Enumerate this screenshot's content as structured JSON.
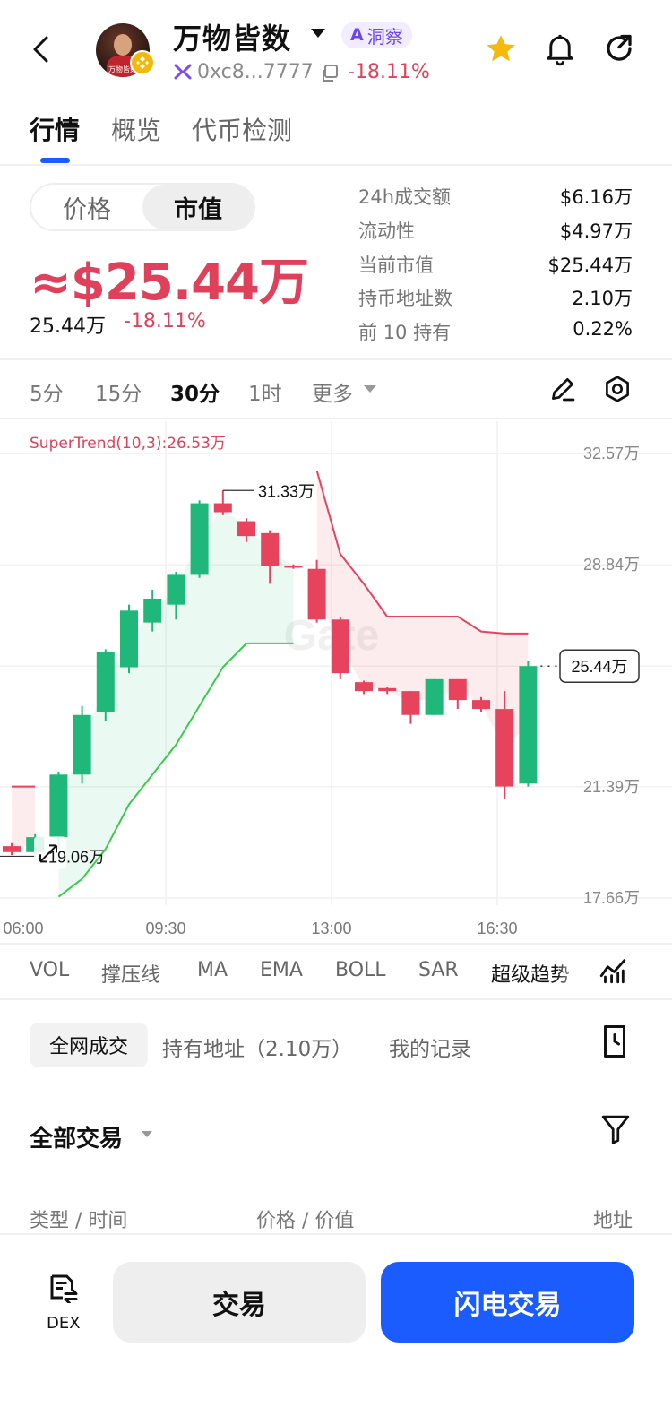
{
  "header": {
    "title": "万物皆数",
    "avatar_caption": "万物皆数",
    "ai_badge": "洞察",
    "address": "0xc8...7777",
    "change": "-18.11%"
  },
  "tabs": [
    "行情",
    "概览",
    "代币检测"
  ],
  "toggle": {
    "left": "价格",
    "right": "市值"
  },
  "market_cap": "≈$25.44万",
  "sub_value": "25.44万",
  "sub_change": "-18.11%",
  "stats": [
    {
      "label": "24h成交额",
      "value": "$6.16万"
    },
    {
      "label": "流动性",
      "value": "$4.97万"
    },
    {
      "label": "当前市值",
      "value": "$25.44万"
    },
    {
      "label": "持币地址数",
      "value": "2.10万"
    },
    {
      "label": "前 10 持有",
      "value": "0.22%"
    }
  ],
  "intervals": [
    "5分",
    "15分",
    "30分",
    "1时",
    "更多"
  ],
  "active_interval": "30分",
  "chart_data": {
    "type": "candlestick",
    "indicator_label": "SuperTrend(10,3):26.53万",
    "y_ticks": [
      "32.57万",
      "28.84万",
      "25.44万",
      "21.39万",
      "17.66万"
    ],
    "x_ticks": [
      "06:00",
      "09:30",
      "13:00",
      "16:30"
    ],
    "ylim": [
      17.66,
      32.57
    ],
    "unit": "万",
    "high_label": "31.33万",
    "low_label": "19.06万",
    "current_label": "25.44万",
    "candles": [
      {
        "o": 19.4,
        "c": 19.2,
        "h": 19.5,
        "l": 19.1
      },
      {
        "o": 19.2,
        "c": 19.7,
        "h": 19.8,
        "l": 19.1
      },
      {
        "o": 19.7,
        "c": 21.8,
        "h": 21.9,
        "l": 19.3
      },
      {
        "o": 21.8,
        "c": 23.8,
        "h": 24.1,
        "l": 21.5
      },
      {
        "o": 23.9,
        "c": 25.9,
        "h": 26.0,
        "l": 23.6
      },
      {
        "o": 25.4,
        "c": 27.3,
        "h": 27.5,
        "l": 25.2
      },
      {
        "o": 26.9,
        "c": 27.7,
        "h": 28.0,
        "l": 26.6
      },
      {
        "o": 27.5,
        "c": 28.5,
        "h": 28.6,
        "l": 27.0
      },
      {
        "o": 28.5,
        "c": 30.9,
        "h": 31.0,
        "l": 28.4
      },
      {
        "o": 30.9,
        "c": 30.6,
        "h": 31.33,
        "l": 30.5
      },
      {
        "o": 30.3,
        "c": 29.8,
        "h": 30.4,
        "l": 29.6
      },
      {
        "o": 29.9,
        "c": 28.8,
        "h": 30.0,
        "l": 28.2
      },
      {
        "o": 28.8,
        "c": 28.75,
        "h": 28.85,
        "l": 28.7
      },
      {
        "o": 28.7,
        "c": 27.0,
        "h": 29.0,
        "l": 26.9
      },
      {
        "o": 27.0,
        "c": 25.2,
        "h": 27.1,
        "l": 25.0
      },
      {
        "o": 24.9,
        "c": 24.6,
        "h": 24.95,
        "l": 24.5
      },
      {
        "o": 24.7,
        "c": 24.6,
        "h": 24.75,
        "l": 24.5
      },
      {
        "o": 24.6,
        "c": 23.8,
        "h": 24.6,
        "l": 23.5
      },
      {
        "o": 23.8,
        "c": 25.0,
        "h": 25.0,
        "l": 23.8
      },
      {
        "o": 25.0,
        "c": 24.3,
        "h": 25.0,
        "l": 24.0
      },
      {
        "o": 24.3,
        "c": 24.0,
        "h": 24.4,
        "l": 23.9
      },
      {
        "o": 24.0,
        "c": 21.4,
        "h": 24.6,
        "l": 21.0
      },
      {
        "o": 21.5,
        "c": 25.44,
        "h": 25.6,
        "l": 21.4
      }
    ],
    "supertrend_up": [
      null,
      null,
      17.7,
      18.3,
      19.3,
      20.8,
      21.8,
      22.8,
      24.1,
      25.4,
      26.2,
      26.2,
      26.2,
      null,
      null,
      null,
      null,
      null,
      null,
      null,
      null,
      null,
      null
    ],
    "supertrend_down": [
      21.4,
      21.4,
      null,
      null,
      null,
      null,
      null,
      null,
      null,
      null,
      null,
      null,
      null,
      32.0,
      29.2,
      28.2,
      27.1,
      27.1,
      27.1,
      27.1,
      26.6,
      26.53,
      26.53
    ]
  },
  "indicators": [
    "VOL",
    "撑压线",
    "MA",
    "EMA",
    "BOLL",
    "SAR",
    "超级趋势"
  ],
  "active_indicator": "超级趋势",
  "trade_tabs": [
    "全网成交",
    "持有地址（2.10万）",
    "我的记录"
  ],
  "all_trades": "全部交易",
  "columns": [
    "类型 / 时间",
    "价格 / 价值",
    "地址"
  ],
  "bottom": {
    "dex": "DEX",
    "trade": "交易",
    "flash": "闪电交易"
  },
  "colors": {
    "up": "#1fb87a",
    "down": "#e8435d",
    "accent": "#1a5cff"
  }
}
